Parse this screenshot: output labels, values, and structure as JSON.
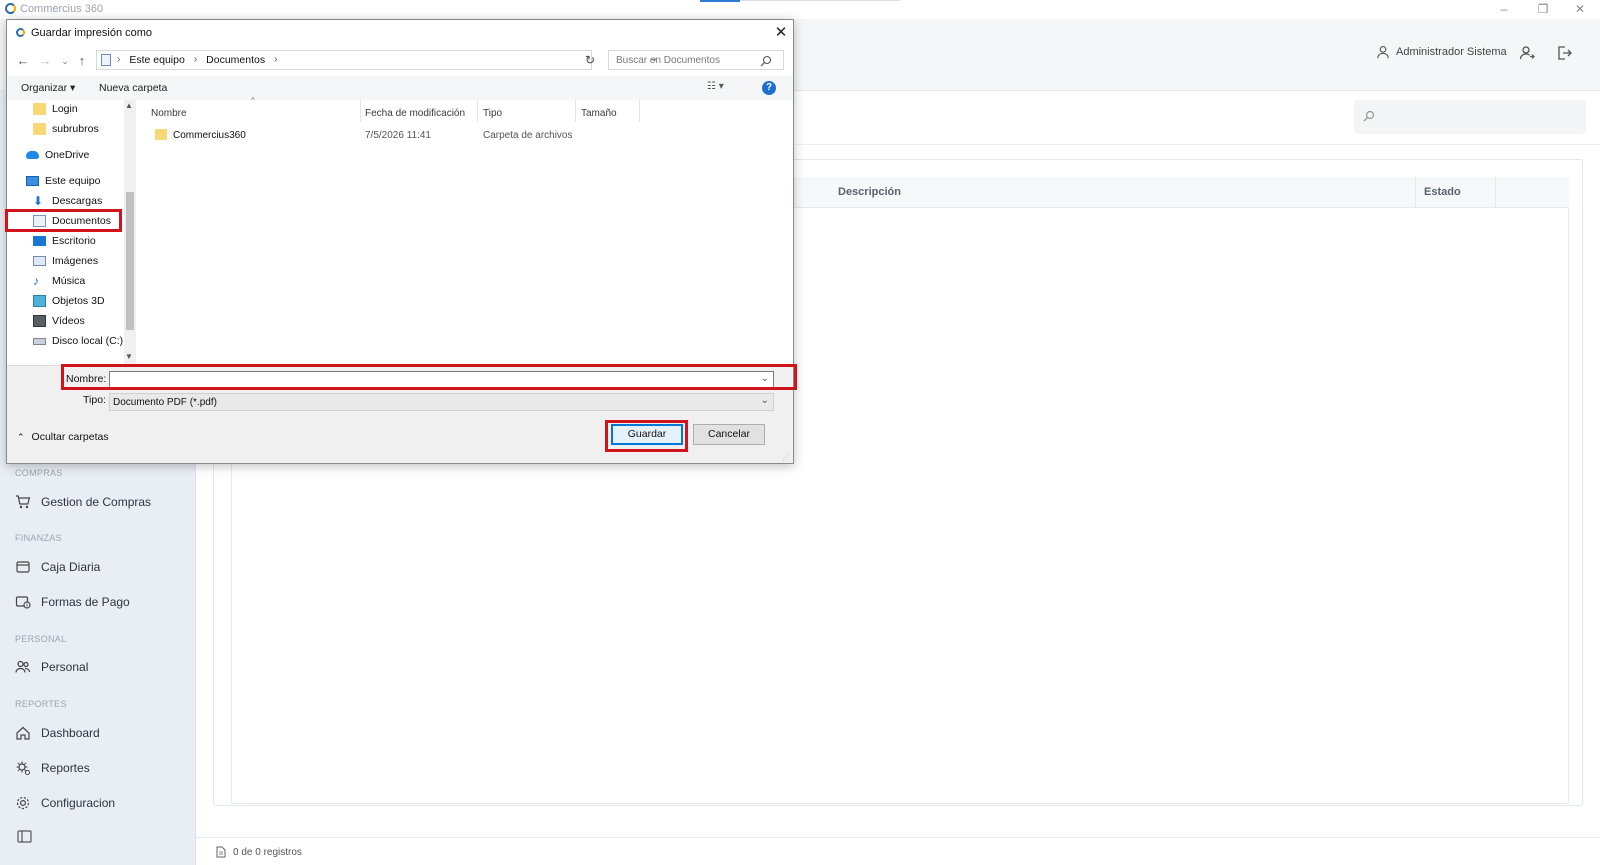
{
  "app": {
    "title": "Commercius 360",
    "user_name": "Administrador Sistema"
  },
  "sidebar": {
    "sections": [
      {
        "label": "COMPRAS",
        "items": [
          {
            "label": "Gestion de Compras",
            "icon": "cart-icon"
          }
        ]
      },
      {
        "label": "FINANZAS",
        "items": [
          {
            "label": "Caja Diaria",
            "icon": "cash-register-icon"
          },
          {
            "label": "Formas de Pago",
            "icon": "payment-methods-icon"
          }
        ]
      },
      {
        "label": "PERSONAL",
        "items": [
          {
            "label": "Personal",
            "icon": "people-icon"
          }
        ]
      },
      {
        "label": "REPORTES",
        "items": [
          {
            "label": "Dashboard",
            "icon": "home-icon"
          },
          {
            "label": "Reportes",
            "icon": "reports-gear-icon"
          },
          {
            "label": "Configuracion",
            "icon": "gear-icon"
          }
        ]
      }
    ]
  },
  "table": {
    "columns": [
      "Descripción",
      "Estado"
    ],
    "footer": "0 de 0 registros"
  },
  "dialog": {
    "title": "Guardar impresión como",
    "breadcrumb": [
      "Este equipo",
      "Documentos"
    ],
    "search_placeholder": "Buscar en Documentos",
    "commands": {
      "organize": "Organizar",
      "new_folder": "Nueva carpeta"
    },
    "nav_items": [
      {
        "label": "Login",
        "icon": "folder-icon"
      },
      {
        "label": "subrubros",
        "icon": "folder-icon"
      },
      {
        "label": "OneDrive",
        "icon": "cloud-icon"
      },
      {
        "label": "Este equipo",
        "icon": "computer-icon"
      },
      {
        "label": "Descargas",
        "icon": "download-icon"
      },
      {
        "label": "Documentos",
        "icon": "document-icon"
      },
      {
        "label": "Escritorio",
        "icon": "desktop-icon"
      },
      {
        "label": "Imágenes",
        "icon": "images-icon"
      },
      {
        "label": "Música",
        "icon": "music-icon"
      },
      {
        "label": "Objetos 3D",
        "icon": "cube-icon"
      },
      {
        "label": "Vídeos",
        "icon": "video-icon"
      },
      {
        "label": "Disco local (C:)",
        "icon": "drive-icon"
      }
    ],
    "columns": [
      "Nombre",
      "Fecha de modificación",
      "Tipo",
      "Tamaño"
    ],
    "files": [
      {
        "name": "Commercius360",
        "modified": "7/5/2026 11:41",
        "type": "Carpeta de archivos",
        "size": ""
      }
    ],
    "filename_label": "Nombre:",
    "filename_value": "",
    "filetype_label": "Tipo:",
    "filetype_value": "Documento PDF (*.pdf)",
    "hide_folders": "Ocultar carpetas",
    "save_button": "Guardar",
    "cancel_button": "Cancelar",
    "highlight_color": "#d1141c"
  }
}
